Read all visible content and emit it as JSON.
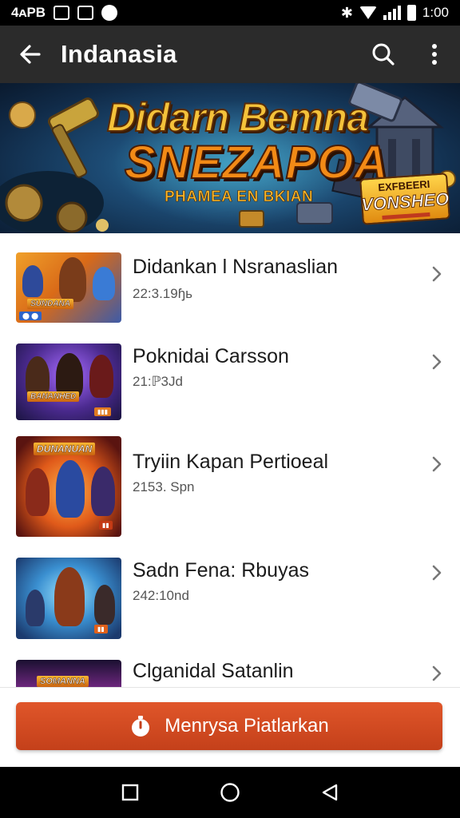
{
  "status_bar": {
    "left_text": "4ᴀPB",
    "time": "1:00",
    "icons": [
      "image-icon",
      "chart-icon",
      "notification-dot-icon",
      "bluetooth-icon",
      "wifi-icon",
      "signal-icon",
      "battery-icon"
    ]
  },
  "app_bar": {
    "title": "Indanasia",
    "back_icon": "arrow-left-icon",
    "actions": [
      "search-icon",
      "more-vert-icon"
    ]
  },
  "banner": {
    "line1": "Didarn Bemna",
    "line2": "SNEZAPOA",
    "line3": "PHAMEA EN BKIAN",
    "badge_top": "EXFBEERI",
    "badge_main": "VONSHEO"
  },
  "list": {
    "items": [
      {
        "title": "Didankan l Nsranaslian",
        "subtitle": "22:3.19ɧь"
      },
      {
        "title": "Poknidai Carsson",
        "subtitle": "21:ℙ3Jd"
      },
      {
        "title": "Tryiin Kapan Pertioeal",
        "subtitle": "2153. Sрn"
      },
      {
        "title": "Sadn Fena: Rbuyas",
        "subtitle": "242:10nd"
      },
      {
        "title": "Clganidal Satanlin",
        "subtitle": ""
      }
    ],
    "chevron_icon": "chevron-right-icon"
  },
  "cta": {
    "label": "Menrysa Piatlarkan",
    "icon": "timer-icon"
  },
  "nav_bar": {
    "buttons": [
      "recents-square-icon",
      "home-circle-icon",
      "back-triangle-icon"
    ]
  },
  "colors": {
    "app_bar": "#2b2b2b",
    "accent": "#d24a20",
    "banner_bg": "#1c4a73"
  }
}
